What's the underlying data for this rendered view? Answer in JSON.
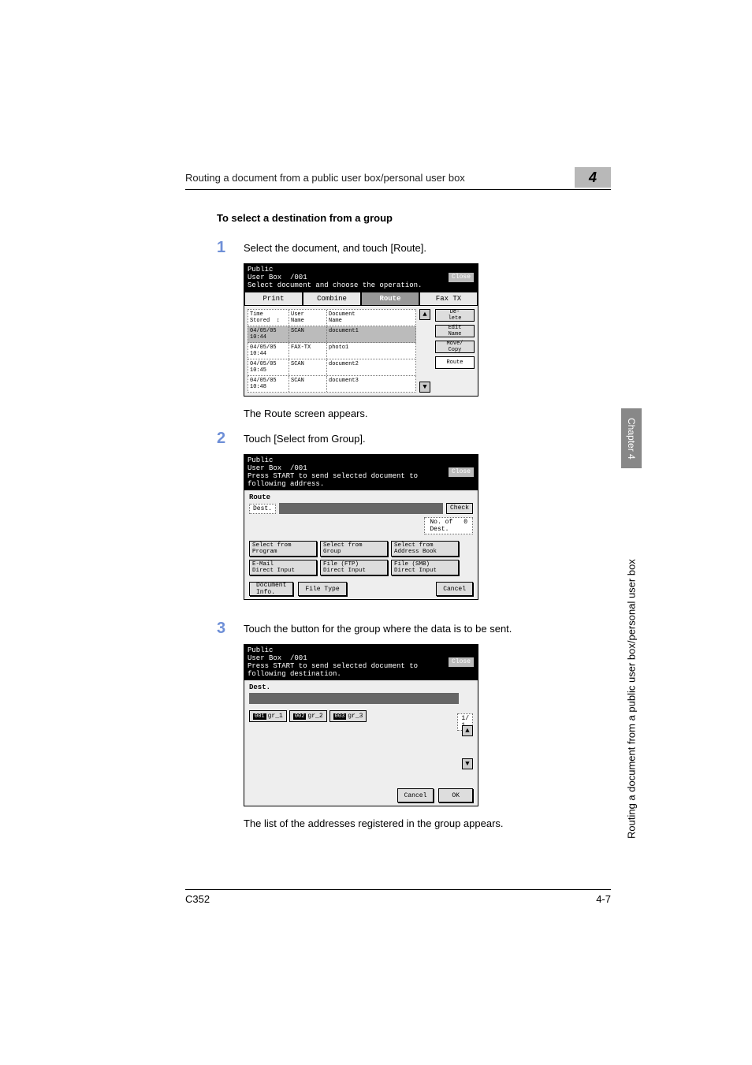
{
  "header": {
    "title": "Routing a document from a public user box/personal user box",
    "chapter_no": "4"
  },
  "sidetab": {
    "label": "Chapter 4",
    "sidelabel": "Routing a document from a public user box/personal user box"
  },
  "section_title": "To select a destination from a group",
  "steps": {
    "1": {
      "num": "1",
      "text": "Select the document, and touch [Route]."
    },
    "result1": "The Route screen appears.",
    "2": {
      "num": "2",
      "text": "Touch [Select from Group]."
    },
    "3": {
      "num": "3",
      "text": "Touch the button for the group where the data is to be sent."
    },
    "result3": "The list of the addresses registered in the group appears."
  },
  "screen1": {
    "title_line1": "Public\nUser Box  /001",
    "title_line2": "Select document and choose the operation.",
    "close": "Close",
    "tabs": {
      "print": "Print",
      "combine": "Combine",
      "route": "Route",
      "faxtx": "Fax TX"
    },
    "cols": {
      "time": "Time\nStored  ↕",
      "user": "User\nName",
      "doc": "Document\nName"
    },
    "rows": [
      {
        "time": "04/05/05\n10:44",
        "user": "SCAN",
        "doc": "document1",
        "selected": true
      },
      {
        "time": "04/05/05\n10:44",
        "user": "FAX-TX",
        "doc": "photo1",
        "selected": false
      },
      {
        "time": "04/05/05\n10:45",
        "user": "SCAN",
        "doc": "document2",
        "selected": false
      },
      {
        "time": "04/05/05\n10:48",
        "user": "SCAN",
        "doc": "document3",
        "selected": false
      }
    ],
    "side": {
      "delete": "De-\nlete",
      "edit": "Edit\nName",
      "copy": "Move/\nCopy",
      "route": "Route"
    },
    "arrows": {
      "up": "▲",
      "dn": "▼"
    }
  },
  "screen2": {
    "title_line1": "Public\nUser Box  /001",
    "title_line2": "Press START to send selected document to\nfollowing address.",
    "close": "Close",
    "route_label": "Route",
    "dest_label": "Dest.",
    "check": "Check",
    "ndest_label": "No. of\nDest.",
    "ndest_value": "0",
    "buttons": {
      "sel_prog": "Select from\nProgram",
      "sel_group": "Select from\nGroup",
      "sel_addr": "Select from\nAddress Book",
      "email": "E-Mail\nDirect Input",
      "ftp": "File (FTP)\nDirect Input",
      "smb": "File (SMB)\nDirect Input"
    },
    "footer": {
      "docinfo": "Document\nInfo.",
      "filetype": "File Type",
      "cancel": "Cancel"
    }
  },
  "screen3": {
    "title_line1": "Public\nUser Box  /001",
    "title_line2": "Press START to send selected document to\nfollowing destination.",
    "close": "Close",
    "dest_label": "Dest.",
    "count": "1/\n1",
    "chips": [
      {
        "num": "001",
        "label": "gr_1"
      },
      {
        "num": "002",
        "label": "gr_2"
      },
      {
        "num": "003",
        "label": "gr_3"
      }
    ],
    "arrows": {
      "up": "▲",
      "dn": "▼"
    },
    "footer": {
      "cancel": "Cancel",
      "ok": "OK"
    }
  },
  "footer": {
    "left": "C352",
    "right": "4-7"
  }
}
